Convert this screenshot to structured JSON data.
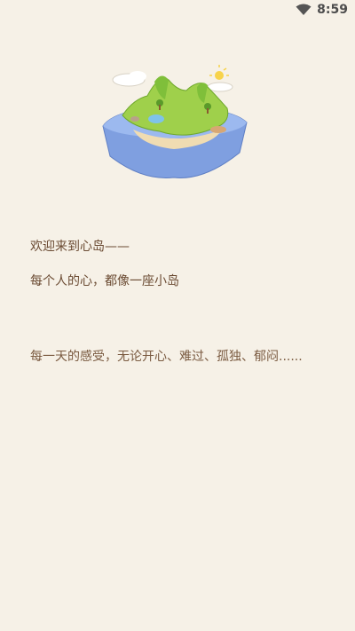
{
  "status_bar": {
    "time": "8:59",
    "wifi_icon": "wifi-icon"
  },
  "hero": {
    "image": "island-illustration"
  },
  "intro": {
    "line1": "欢迎来到心岛——",
    "line2": "每个人的心，都像一座小岛",
    "line3": "每一天的感受，无论开心、难过、孤独、郁闷......"
  },
  "colors": {
    "background": "#f6f1e7",
    "text": "#6b4b33",
    "island_water": "#8fb3ea",
    "island_grass": "#9fd04b",
    "island_sand": "#f0dcb2"
  }
}
